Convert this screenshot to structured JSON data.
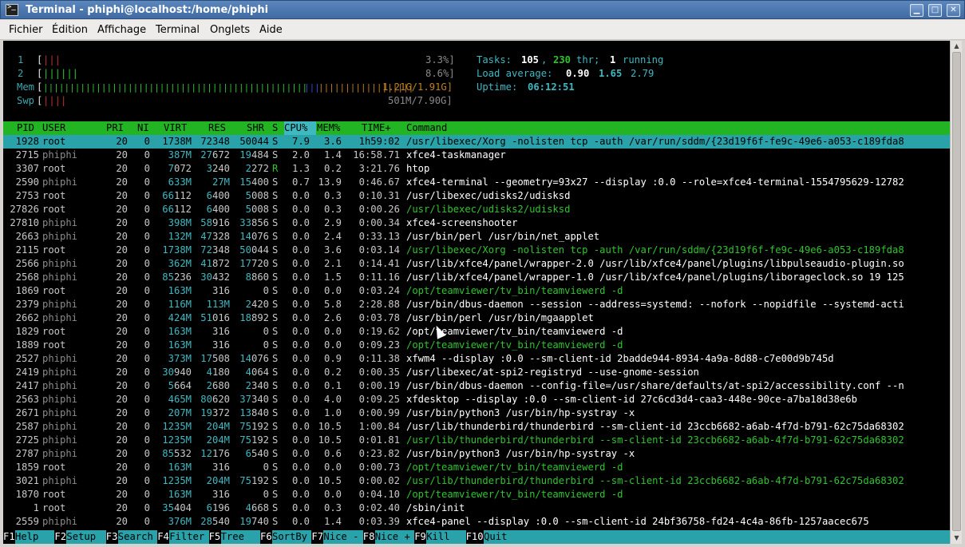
{
  "window": {
    "title": "Terminal - phiphi@localhost:/home/phiphi",
    "buttons": {
      "minimize": "▁",
      "maximize": "□",
      "close": "✕"
    }
  },
  "menu": [
    "Fichier",
    "Édition",
    "Affichage",
    "Terminal",
    "Onglets",
    "Aide"
  ],
  "meters": {
    "cpu1": {
      "label": "1",
      "bars": "|||",
      "value": "3.3%]"
    },
    "cpu2": {
      "label": "2",
      "bars": "||||||",
      "value": "8.6%]"
    },
    "mem": {
      "label": "Mem",
      "bars_green": "||||||||||||||||||||||||||||||||||||||||||||||||||",
      "bars_blue": "|||",
      "bars_orange": "||||||||||||||||||",
      "value": "1.21G/1.91G]"
    },
    "swp": {
      "label": "Swp",
      "bars": "||||",
      "value": "501M/7.90G]"
    }
  },
  "stats": {
    "tasks_label": "Tasks:",
    "tasks": "105",
    "thr": "230",
    "thr_label": "thr;",
    "running": "1",
    "running_label": "running",
    "load_label": "Load average:",
    "load1": "0.90",
    "load5": "1.65",
    "load15": "2.79",
    "uptime_label": "Uptime:",
    "uptime": "06:12:51"
  },
  "header": [
    "PID",
    "USER",
    "PRI",
    "NI",
    "VIRT",
    "RES",
    "SHR",
    "S",
    "CPU%",
    "MEM%",
    "TIME+",
    "Command"
  ],
  "processes": [
    {
      "pid": "1928",
      "user": "root",
      "pri": "20",
      "ni": "0",
      "virt": "1738M",
      "res": "72348",
      "shr": "50044",
      "s": "S",
      "cpu": "7.9",
      "mem": "3.6",
      "time": "1h59:02",
      "cmd": "/usr/libexec/Xorg -nolisten tcp -auth /var/run/sddm/{23d19f6f-fe9c-49e6-a053-c189fda8",
      "sel": true
    },
    {
      "pid": "2715",
      "user": "phiphi",
      "pri": "20",
      "ni": "0",
      "virt": "387M",
      "res": "27672",
      "shr": "19484",
      "s": "S",
      "cpu": "2.0",
      "mem": "1.4",
      "time": "16:58.71",
      "cmd": "xfce4-taskmanager"
    },
    {
      "pid": "3307",
      "user": "root",
      "pri": "20",
      "ni": "0",
      "virt": "7072",
      "res": "3240",
      "shr": "2272",
      "s": "R",
      "cpu": "1.3",
      "mem": "0.2",
      "time": "3:21.76",
      "cmd": "htop"
    },
    {
      "pid": "2590",
      "user": "phiphi",
      "pri": "20",
      "ni": "0",
      "virt": "633M",
      "res": "27M",
      "shr": "15400",
      "s": "S",
      "cpu": "0.7",
      "mem": "13.9",
      "time": "0:46.67",
      "cmd": "xfce4-terminal --geometry=93x27 --display :0.0 --role=xfce4-terminal-1554795629-12782"
    },
    {
      "pid": "2753",
      "user": "root",
      "pri": "20",
      "ni": "0",
      "virt": "66112",
      "res": "6400",
      "shr": "5008",
      "s": "S",
      "cpu": "0.0",
      "mem": "0.3",
      "time": "0:10.31",
      "cmd": "/usr/libexec/udisks2/udisksd"
    },
    {
      "pid": "27826",
      "user": "root",
      "pri": "20",
      "ni": "0",
      "virt": "66112",
      "res": "6400",
      "shr": "5008",
      "s": "S",
      "cpu": "0.0",
      "mem": "0.3",
      "time": "0:00.26",
      "cmd": "/usr/libexec/udisks2/udisksd",
      "thread": true
    },
    {
      "pid": "27810",
      "user": "phiphi",
      "pri": "20",
      "ni": "0",
      "virt": "398M",
      "res": "58916",
      "shr": "33856",
      "s": "S",
      "cpu": "0.0",
      "mem": "2.9",
      "time": "0:00.34",
      "cmd": "xfce4-screenshooter"
    },
    {
      "pid": "2663",
      "user": "phiphi",
      "pri": "20",
      "ni": "0",
      "virt": "132M",
      "res": "47328",
      "shr": "14076",
      "s": "S",
      "cpu": "0.0",
      "mem": "2.4",
      "time": "0:33.13",
      "cmd": "/usr/bin/perl /usr/bin/net_applet"
    },
    {
      "pid": "2115",
      "user": "root",
      "pri": "20",
      "ni": "0",
      "virt": "1738M",
      "res": "72348",
      "shr": "50044",
      "s": "S",
      "cpu": "0.0",
      "mem": "3.6",
      "time": "0:03.14",
      "cmd": "/usr/libexec/Xorg -nolisten tcp -auth /var/run/sddm/{23d19f6f-fe9c-49e6-a053-c189fda8",
      "thread": true
    },
    {
      "pid": "2566",
      "user": "phiphi",
      "pri": "20",
      "ni": "0",
      "virt": "362M",
      "res": "41872",
      "shr": "17720",
      "s": "S",
      "cpu": "0.0",
      "mem": "2.1",
      "time": "0:14.41",
      "cmd": "/usr/lib/xfce4/panel/wrapper-2.0 /usr/lib/xfce4/panel/plugins/libpulseaudio-plugin.so"
    },
    {
      "pid": "2568",
      "user": "phiphi",
      "pri": "20",
      "ni": "0",
      "virt": "85236",
      "res": "30432",
      "shr": "8860",
      "s": "S",
      "cpu": "0.0",
      "mem": "1.5",
      "time": "0:11.16",
      "cmd": "/usr/lib/xfce4/panel/wrapper-1.0 /usr/lib/xfce4/panel/plugins/liborageclock.so 19 125"
    },
    {
      "pid": "1869",
      "user": "root",
      "pri": "20",
      "ni": "0",
      "virt": "163M",
      "res": "316",
      "shr": "0",
      "s": "S",
      "cpu": "0.0",
      "mem": "0.0",
      "time": "0:03.24",
      "cmd": "/opt/teamviewer/tv_bin/teamviewerd -d",
      "thread": true
    },
    {
      "pid": "2379",
      "user": "phiphi",
      "pri": "20",
      "ni": "0",
      "virt": "116M",
      "res": "113M",
      "shr": "2420",
      "s": "S",
      "cpu": "0.0",
      "mem": "5.8",
      "time": "2:28.88",
      "cmd": "/usr/bin/dbus-daemon --session --address=systemd: --nofork --nopidfile --systemd-acti"
    },
    {
      "pid": "2662",
      "user": "phiphi",
      "pri": "20",
      "ni": "0",
      "virt": "424M",
      "res": "51016",
      "shr": "18892",
      "s": "S",
      "cpu": "0.0",
      "mem": "2.6",
      "time": "0:03.78",
      "cmd": "/usr/bin/perl /usr/bin/mgaapplet"
    },
    {
      "pid": "1829",
      "user": "root",
      "pri": "20",
      "ni": "0",
      "virt": "163M",
      "res": "316",
      "shr": "0",
      "s": "S",
      "cpu": "0.0",
      "mem": "0.0",
      "time": "0:19.62",
      "cmd": "/opt/teamviewer/tv_bin/teamviewerd -d"
    },
    {
      "pid": "1889",
      "user": "root",
      "pri": "20",
      "ni": "0",
      "virt": "163M",
      "res": "316",
      "shr": "0",
      "s": "S",
      "cpu": "0.0",
      "mem": "0.0",
      "time": "0:09.23",
      "cmd": "/opt/teamviewer/tv_bin/teamviewerd -d",
      "thread": true
    },
    {
      "pid": "2527",
      "user": "phiphi",
      "pri": "20",
      "ni": "0",
      "virt": "373M",
      "res": "17508",
      "shr": "14076",
      "s": "S",
      "cpu": "0.0",
      "mem": "0.9",
      "time": "0:11.38",
      "cmd": "xfwm4 --display :0.0 --sm-client-id 2badde944-8934-4a9a-8d88-c7e00d9b745d"
    },
    {
      "pid": "2419",
      "user": "phiphi",
      "pri": "20",
      "ni": "0",
      "virt": "30940",
      "res": "4180",
      "shr": "4064",
      "s": "S",
      "cpu": "0.0",
      "mem": "0.2",
      "time": "0:00.35",
      "cmd": "/usr/libexec/at-spi2-registryd --use-gnome-session"
    },
    {
      "pid": "2417",
      "user": "phiphi",
      "pri": "20",
      "ni": "0",
      "virt": "5664",
      "res": "2680",
      "shr": "2340",
      "s": "S",
      "cpu": "0.0",
      "mem": "0.1",
      "time": "0:00.19",
      "cmd": "/usr/bin/dbus-daemon --config-file=/usr/share/defaults/at-spi2/accessibility.conf --n"
    },
    {
      "pid": "2563",
      "user": "phiphi",
      "pri": "20",
      "ni": "0",
      "virt": "465M",
      "res": "80620",
      "shr": "37340",
      "s": "S",
      "cpu": "0.0",
      "mem": "4.0",
      "time": "0:09.25",
      "cmd": "xfdesktop --display :0.0 --sm-client-id 27c6cd3d4-caa3-448e-90ce-a7ba18d38e6b"
    },
    {
      "pid": "2671",
      "user": "phiphi",
      "pri": "20",
      "ni": "0",
      "virt": "207M",
      "res": "19372",
      "shr": "13840",
      "s": "S",
      "cpu": "0.0",
      "mem": "1.0",
      "time": "0:00.99",
      "cmd": "/usr/bin/python3 /usr/bin/hp-systray -x"
    },
    {
      "pid": "2587",
      "user": "phiphi",
      "pri": "20",
      "ni": "0",
      "virt": "1235M",
      "res": "204M",
      "shr": "75192",
      "s": "S",
      "cpu": "0.0",
      "mem": "10.5",
      "time": "1:00.84",
      "cmd": "/usr/lib/thunderbird/thunderbird --sm-client-id 23ccb6682-a6ab-4f7d-b791-62c75da68302"
    },
    {
      "pid": "2725",
      "user": "phiphi",
      "pri": "20",
      "ni": "0",
      "virt": "1235M",
      "res": "204M",
      "shr": "75192",
      "s": "S",
      "cpu": "0.0",
      "mem": "10.5",
      "time": "0:01.81",
      "cmd": "/usr/lib/thunderbird/thunderbird --sm-client-id 23ccb6682-a6ab-4f7d-b791-62c75da68302",
      "thread": true
    },
    {
      "pid": "2787",
      "user": "phiphi",
      "pri": "20",
      "ni": "0",
      "virt": "85532",
      "res": "12176",
      "shr": "6540",
      "s": "S",
      "cpu": "0.0",
      "mem": "0.6",
      "time": "0:23.82",
      "cmd": "/usr/bin/python3 /usr/bin/hp-systray -x"
    },
    {
      "pid": "1859",
      "user": "root",
      "pri": "20",
      "ni": "0",
      "virt": "163M",
      "res": "316",
      "shr": "0",
      "s": "S",
      "cpu": "0.0",
      "mem": "0.0",
      "time": "0:00.73",
      "cmd": "/opt/teamviewer/tv_bin/teamviewerd -d",
      "thread": true
    },
    {
      "pid": "3021",
      "user": "phiphi",
      "pri": "20",
      "ni": "0",
      "virt": "1235M",
      "res": "204M",
      "shr": "75192",
      "s": "S",
      "cpu": "0.0",
      "mem": "10.5",
      "time": "0:00.02",
      "cmd": "/usr/lib/thunderbird/thunderbird --sm-client-id 23ccb6682-a6ab-4f7d-b791-62c75da68302",
      "thread": true
    },
    {
      "pid": "1870",
      "user": "root",
      "pri": "20",
      "ni": "0",
      "virt": "163M",
      "res": "316",
      "shr": "0",
      "s": "S",
      "cpu": "0.0",
      "mem": "0.0",
      "time": "0:04.10",
      "cmd": "/opt/teamviewer/tv_bin/teamviewerd -d",
      "thread": true
    },
    {
      "pid": "1",
      "user": "root",
      "pri": "20",
      "ni": "0",
      "virt": "35404",
      "res": "6196",
      "shr": "4668",
      "s": "S",
      "cpu": "0.0",
      "mem": "0.3",
      "time": "0:02.40",
      "cmd": "/sbin/init"
    },
    {
      "pid": "2559",
      "user": "phiphi",
      "pri": "20",
      "ni": "0",
      "virt": "376M",
      "res": "28540",
      "shr": "19740",
      "s": "S",
      "cpu": "0.0",
      "mem": "1.4",
      "time": "0:03.39",
      "cmd": "xfce4-panel --display :0.0 --sm-client-id 24bf36758-fd24-4c4a-86fb-1257aacec675"
    }
  ],
  "footer": [
    {
      "key": "F1",
      "label": "Help  "
    },
    {
      "key": "F2",
      "label": "Setup "
    },
    {
      "key": "F3",
      "label": "Search"
    },
    {
      "key": "F4",
      "label": "Filter"
    },
    {
      "key": "F5",
      "label": "Tree  "
    },
    {
      "key": "F6",
      "label": "SortBy"
    },
    {
      "key": "F7",
      "label": "Nice -"
    },
    {
      "key": "F8",
      "label": "Nice +"
    },
    {
      "key": "F9",
      "label": "Kill  "
    },
    {
      "key": "F10",
      "label": "Quit"
    }
  ],
  "colors": {
    "header_bg": "#22b422",
    "selected_bg": "#2aa2aa",
    "title_bg": "#4a78b0"
  }
}
